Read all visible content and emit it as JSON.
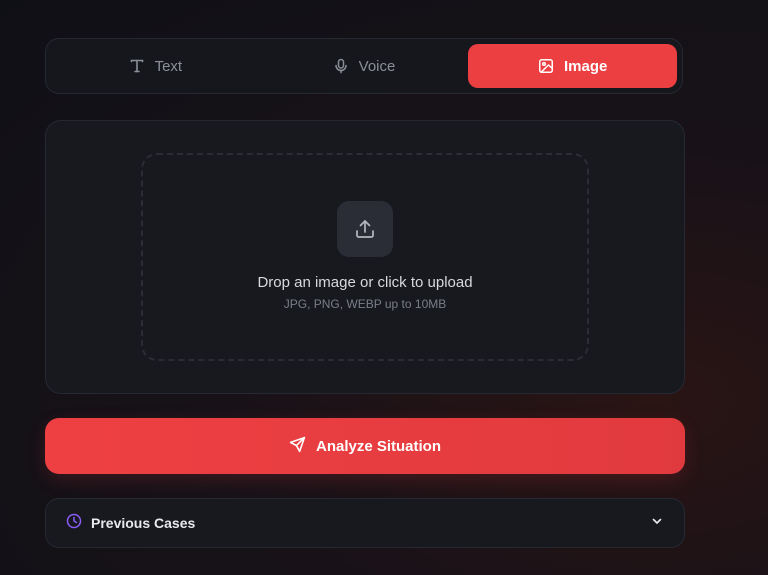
{
  "tabs": [
    {
      "label": "Text",
      "icon": "text-icon",
      "active": false
    },
    {
      "label": "Voice",
      "icon": "microphone-icon",
      "active": false
    },
    {
      "label": "Image",
      "icon": "image-icon",
      "active": true
    }
  ],
  "upload": {
    "title": "Drop an image or click to upload",
    "subtitle": "JPG, PNG, WEBP up to 10MB",
    "icon": "upload-icon"
  },
  "analyze": {
    "label": "Analyze Situation",
    "icon": "send-icon"
  },
  "previous_cases": {
    "label": "Previous Cases",
    "icon": "clock-icon",
    "toggle_icon": "chevron-down-icon"
  },
  "colors": {
    "accent": "#ec3f42",
    "clock_icon": "#8b5cf6"
  }
}
